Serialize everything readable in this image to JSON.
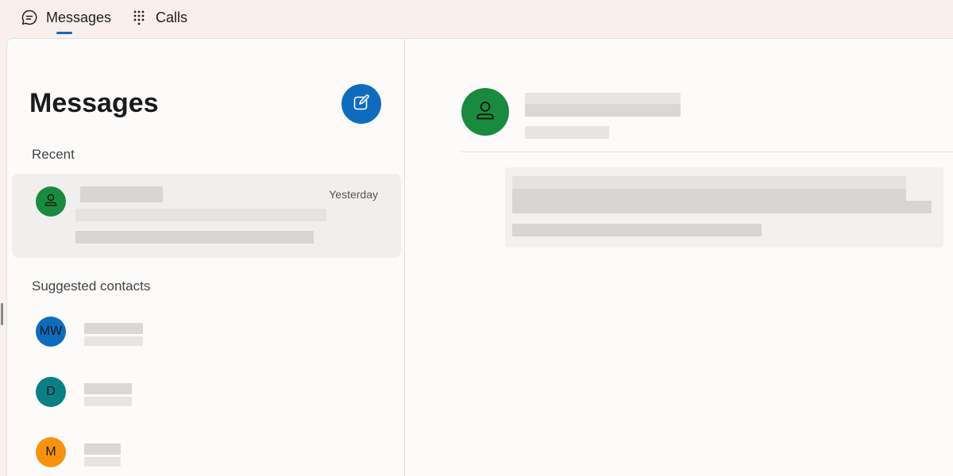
{
  "nav": {
    "tabs": [
      {
        "label": "Messages",
        "icon": "chat-bubble-icon",
        "active": true
      },
      {
        "label": "Calls",
        "icon": "dialpad-icon",
        "active": false
      }
    ],
    "accent": "#0f6cbd"
  },
  "left": {
    "title": "Messages",
    "compose_icon": "compose-icon",
    "recent_label": "Recent",
    "suggested_label": "Suggested contacts",
    "recent": [
      {
        "avatar_icon": "person-icon",
        "avatar_color": "#1a8a3e",
        "time": "Yesterday"
      }
    ],
    "contacts": [
      {
        "initials": "MW",
        "color": "#0f6cbd"
      },
      {
        "initials": "D",
        "color": "#0a7f86"
      },
      {
        "initials": "M",
        "color": "#f7920e"
      }
    ]
  },
  "right": {
    "avatar_icon": "person-icon",
    "avatar_color": "#1a8a3e"
  }
}
